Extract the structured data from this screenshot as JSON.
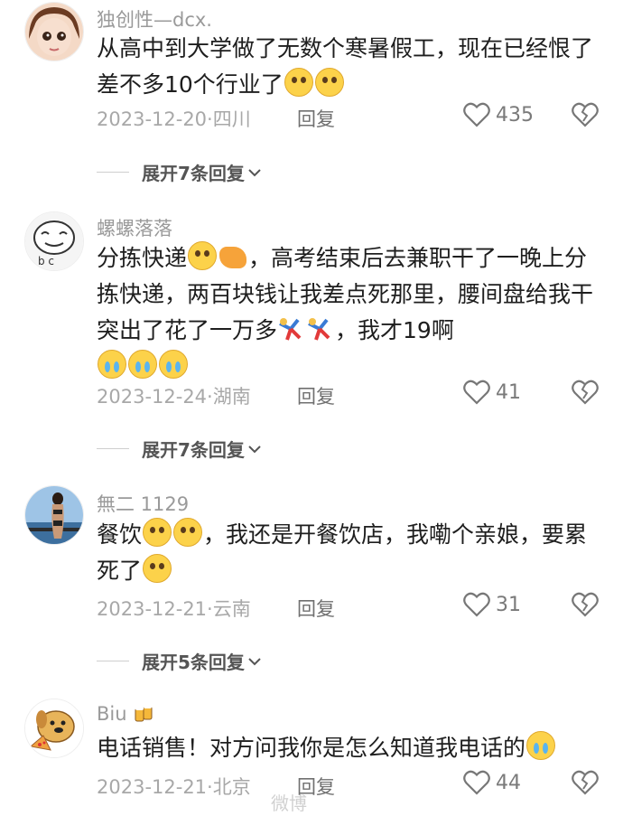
{
  "comments": [
    {
      "username": "独创性—dcx.",
      "text": "从高中到大学做了无数个寒暑假工，现在已经恨了差不多10个行业了",
      "date": "2023-12-20",
      "location": "四川",
      "reply_label": "回复",
      "likes": "435",
      "expand_label": "展开7条回复",
      "emojis": [
        "laugh-sweat-emoji",
        "flushed-emoji"
      ]
    },
    {
      "username": "螺螺落落",
      "text_a": "分拣快递",
      "text_b": "，高考结束后去兼职干了一晚上分拣快递，两百块钱让我差点死那里，腰间盘给我干突出了花了一万多",
      "text_c": "，我才19啊",
      "date": "2023-12-24",
      "location": "湖南",
      "reply_label": "回复",
      "likes": "41",
      "expand_label": "展开7条回复",
      "emojis": [
        "flushed-emoji",
        "pointing-hand-emoji",
        "dancer-emoji",
        "dancer-emoji",
        "crying-emoji",
        "crying-emoji",
        "crying-emoji"
      ]
    },
    {
      "username": "無二 1129",
      "text_a": "餐饮",
      "text_b": "，我还是开餐饮店，我嘞个亲娘，要累死了",
      "date": "2023-12-21",
      "location": "云南",
      "reply_label": "回复",
      "likes": "31",
      "expand_label": "展开5条回复",
      "emojis": [
        "pleading-emoji",
        "pleading-emoji",
        "pleading-emoji"
      ]
    },
    {
      "username": "Biu",
      "text": "电话销售！对方问我你是怎么知道我电话的",
      "date": "2023-12-21",
      "location": "北京",
      "reply_label": "回复",
      "likes": "44",
      "emojis": [
        "beer-emoji",
        "laughing-crying-emoji"
      ]
    }
  ],
  "watermark": "微博"
}
